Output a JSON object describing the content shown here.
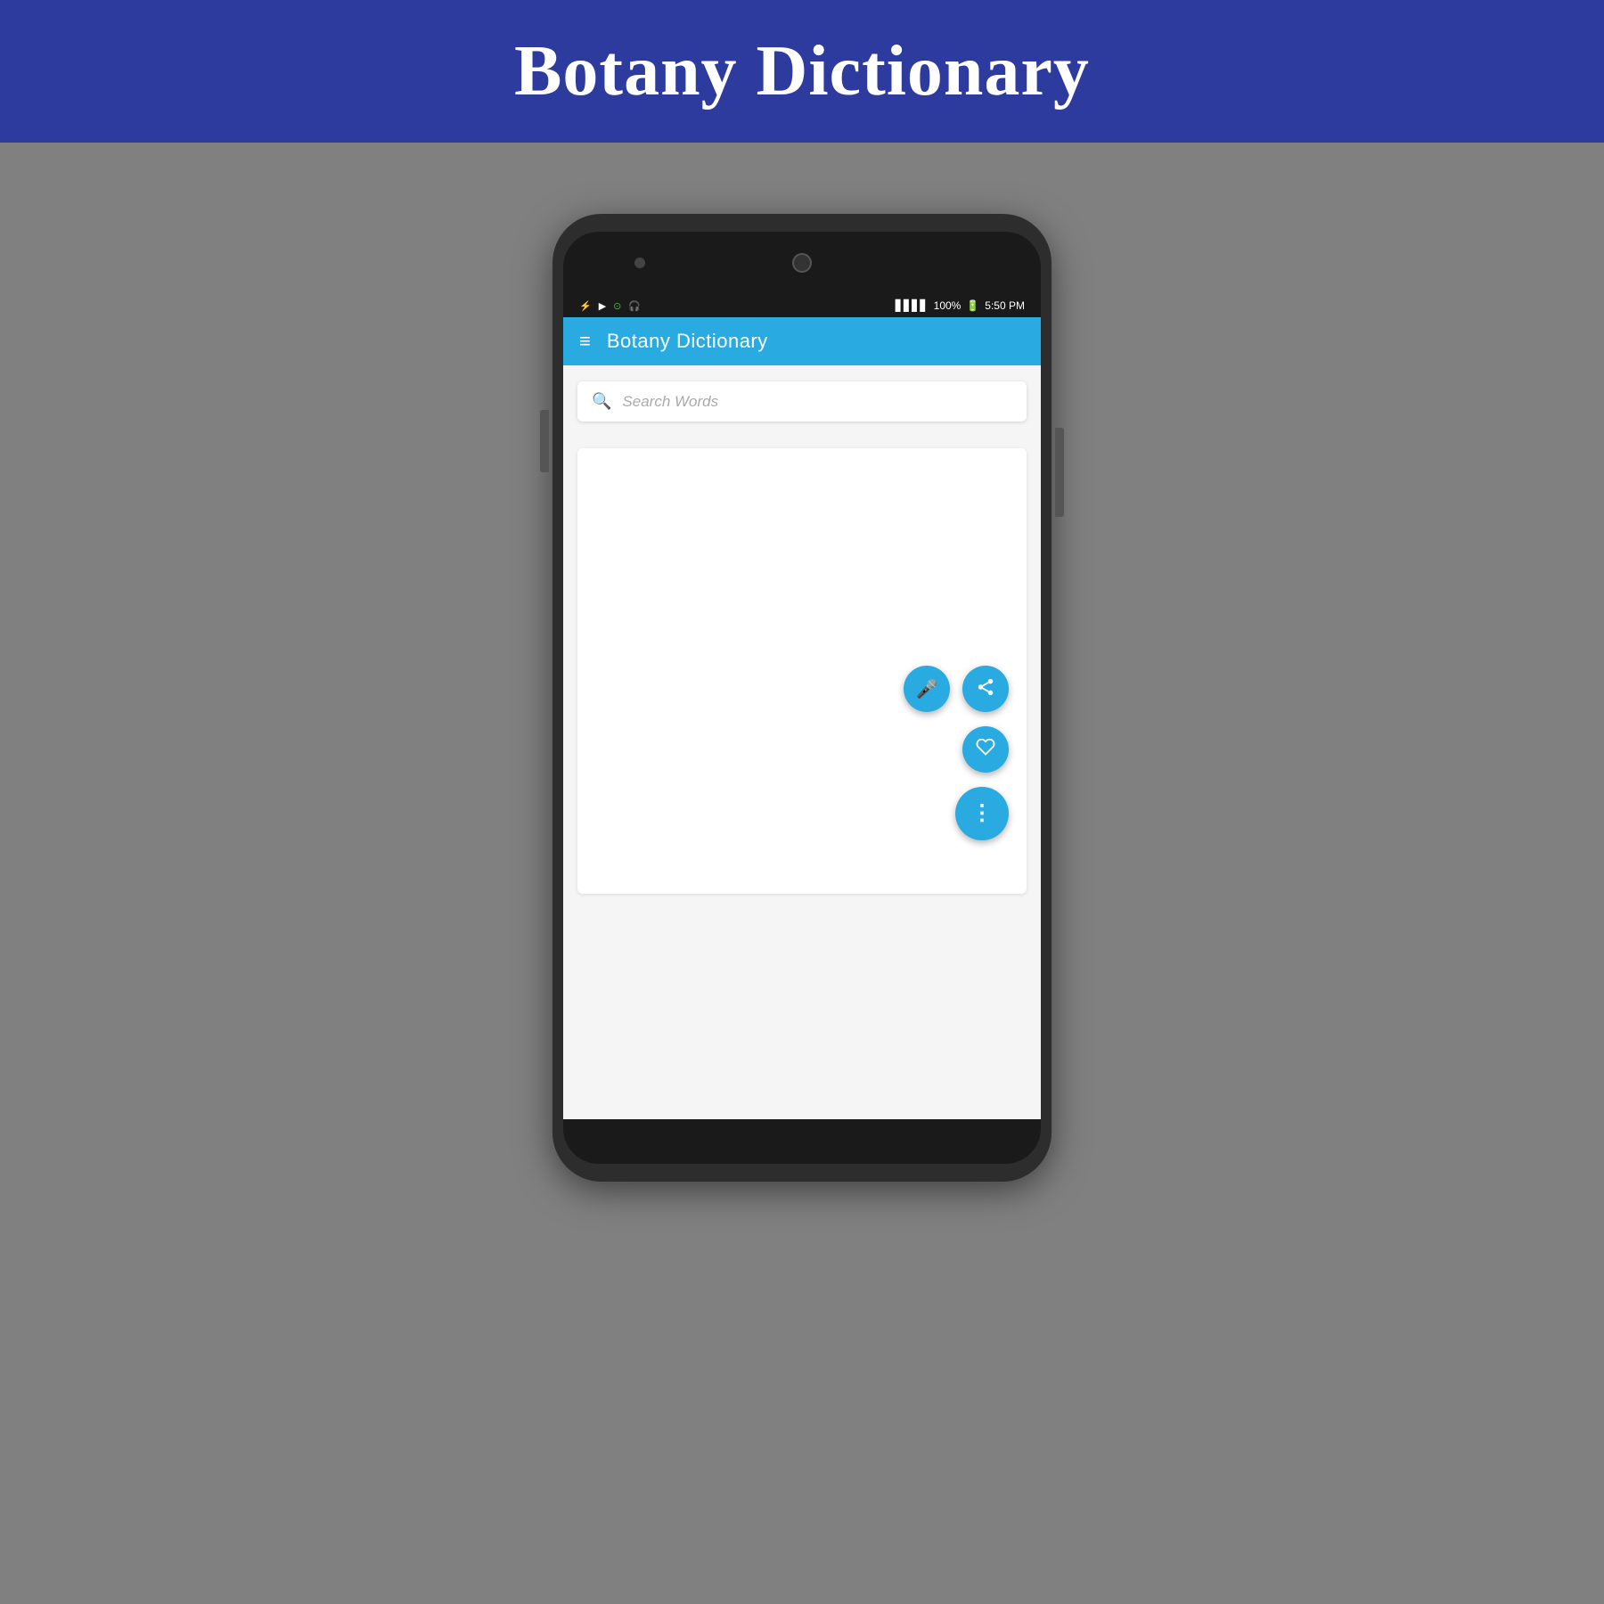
{
  "banner": {
    "title": "Botany Dictionary",
    "background_color": "#2d3a9e"
  },
  "status_bar": {
    "time": "5:50 PM",
    "battery": "100%",
    "icons": [
      "usb-icon",
      "play-icon",
      "circle-icon",
      "headphone-icon"
    ]
  },
  "app_bar": {
    "title": "Botany Dictionary",
    "background_color": "#29abe2",
    "hamburger_label": "≡"
  },
  "search": {
    "placeholder": "Search Words",
    "icon": "search-icon"
  },
  "fab_buttons": [
    {
      "id": "share-fab",
      "icon": "share-icon",
      "symbol": "⬡",
      "label": "Share"
    },
    {
      "id": "mic-fab",
      "icon": "mic-icon",
      "symbol": "🎤",
      "label": "Microphone"
    },
    {
      "id": "favorite-fab",
      "icon": "heart-icon",
      "symbol": "♡",
      "label": "Favorite"
    },
    {
      "id": "more-fab",
      "icon": "more-icon",
      "symbol": "⋮",
      "label": "More options"
    }
  ]
}
